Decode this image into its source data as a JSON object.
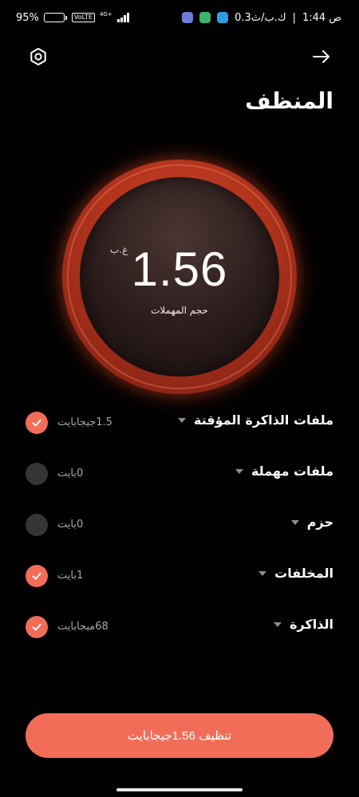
{
  "status_bar": {
    "battery": "95%",
    "volte": "VoLTE",
    "network": "4G+",
    "speed": "0.3ك.ب/ث",
    "time": "1:44 ص"
  },
  "header": {
    "title": "المنظف"
  },
  "gauge": {
    "value": "1.56",
    "unit": "غ.ب",
    "caption": "حجم المهملات"
  },
  "categories": [
    {
      "name": "ملفات الذاكرة المؤقتة",
      "size": "1.5جيجابايت",
      "checked": true
    },
    {
      "name": "ملفات مهملة",
      "size": "0بايت",
      "checked": false
    },
    {
      "name": "حزم",
      "size": "0بايت",
      "checked": false
    },
    {
      "name": "المخلفات",
      "size": "1بايت",
      "checked": true
    },
    {
      "name": "الذاكرة",
      "size": "68ميجابايت",
      "checked": true
    }
  ],
  "clean_button": {
    "label": "تنظيف 1.56جيجابايت"
  },
  "colors": {
    "accent": "#f26d58",
    "background": "#000000"
  },
  "icons": {
    "settings": "gear-icon",
    "back": "arrow-right-icon",
    "check": "checkmark-icon"
  }
}
